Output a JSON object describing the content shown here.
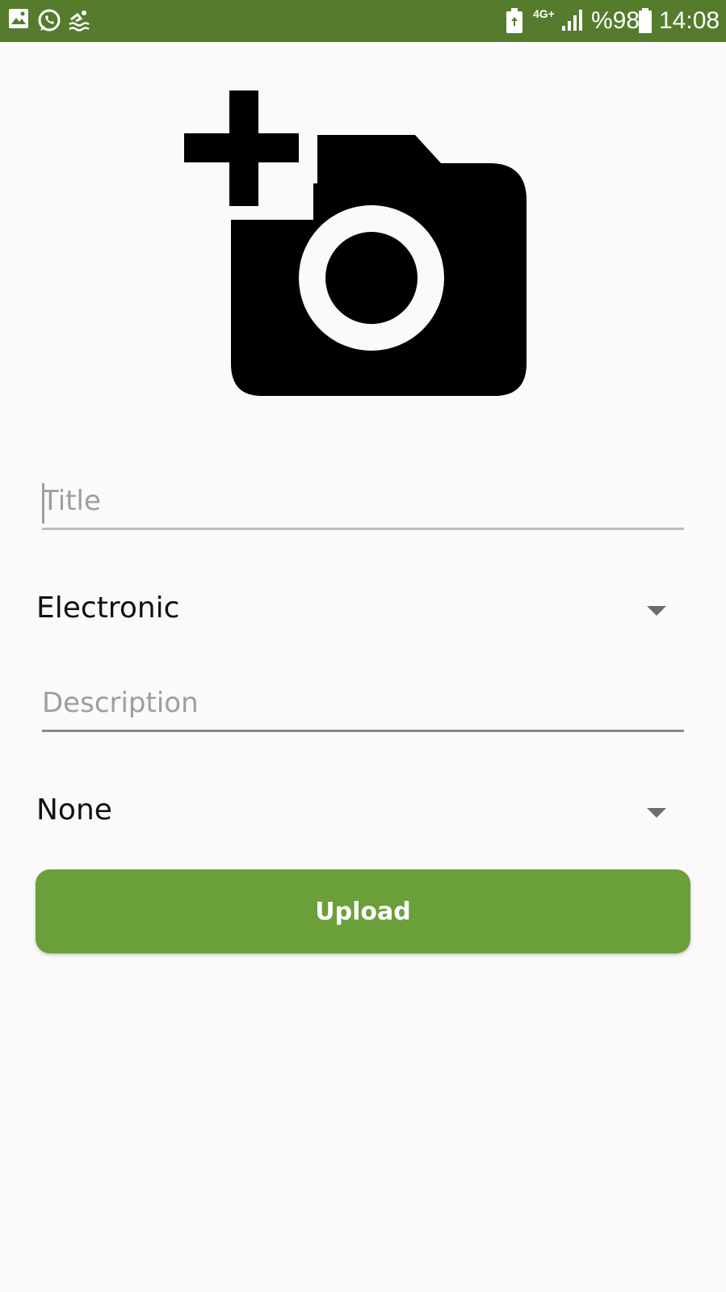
{
  "status_bar": {
    "battery_percent": "%98",
    "time": "14:08",
    "network": "4G+",
    "icons": [
      "image-icon",
      "whatsapp-icon",
      "swim-icon",
      "battery-saver-icon",
      "signal-icon",
      "battery-icon"
    ]
  },
  "photo_picker": {
    "icon": "add-a-photo-icon"
  },
  "form": {
    "title_placeholder": "Title",
    "title_value": "",
    "category_value": "Electronic",
    "description_placeholder": "Description",
    "description_value": "",
    "option_value": "None",
    "upload_label": "Upload"
  },
  "colors": {
    "status_bar": "#557b2d",
    "accent": "#6a9f3a",
    "background": "#fafafa"
  }
}
